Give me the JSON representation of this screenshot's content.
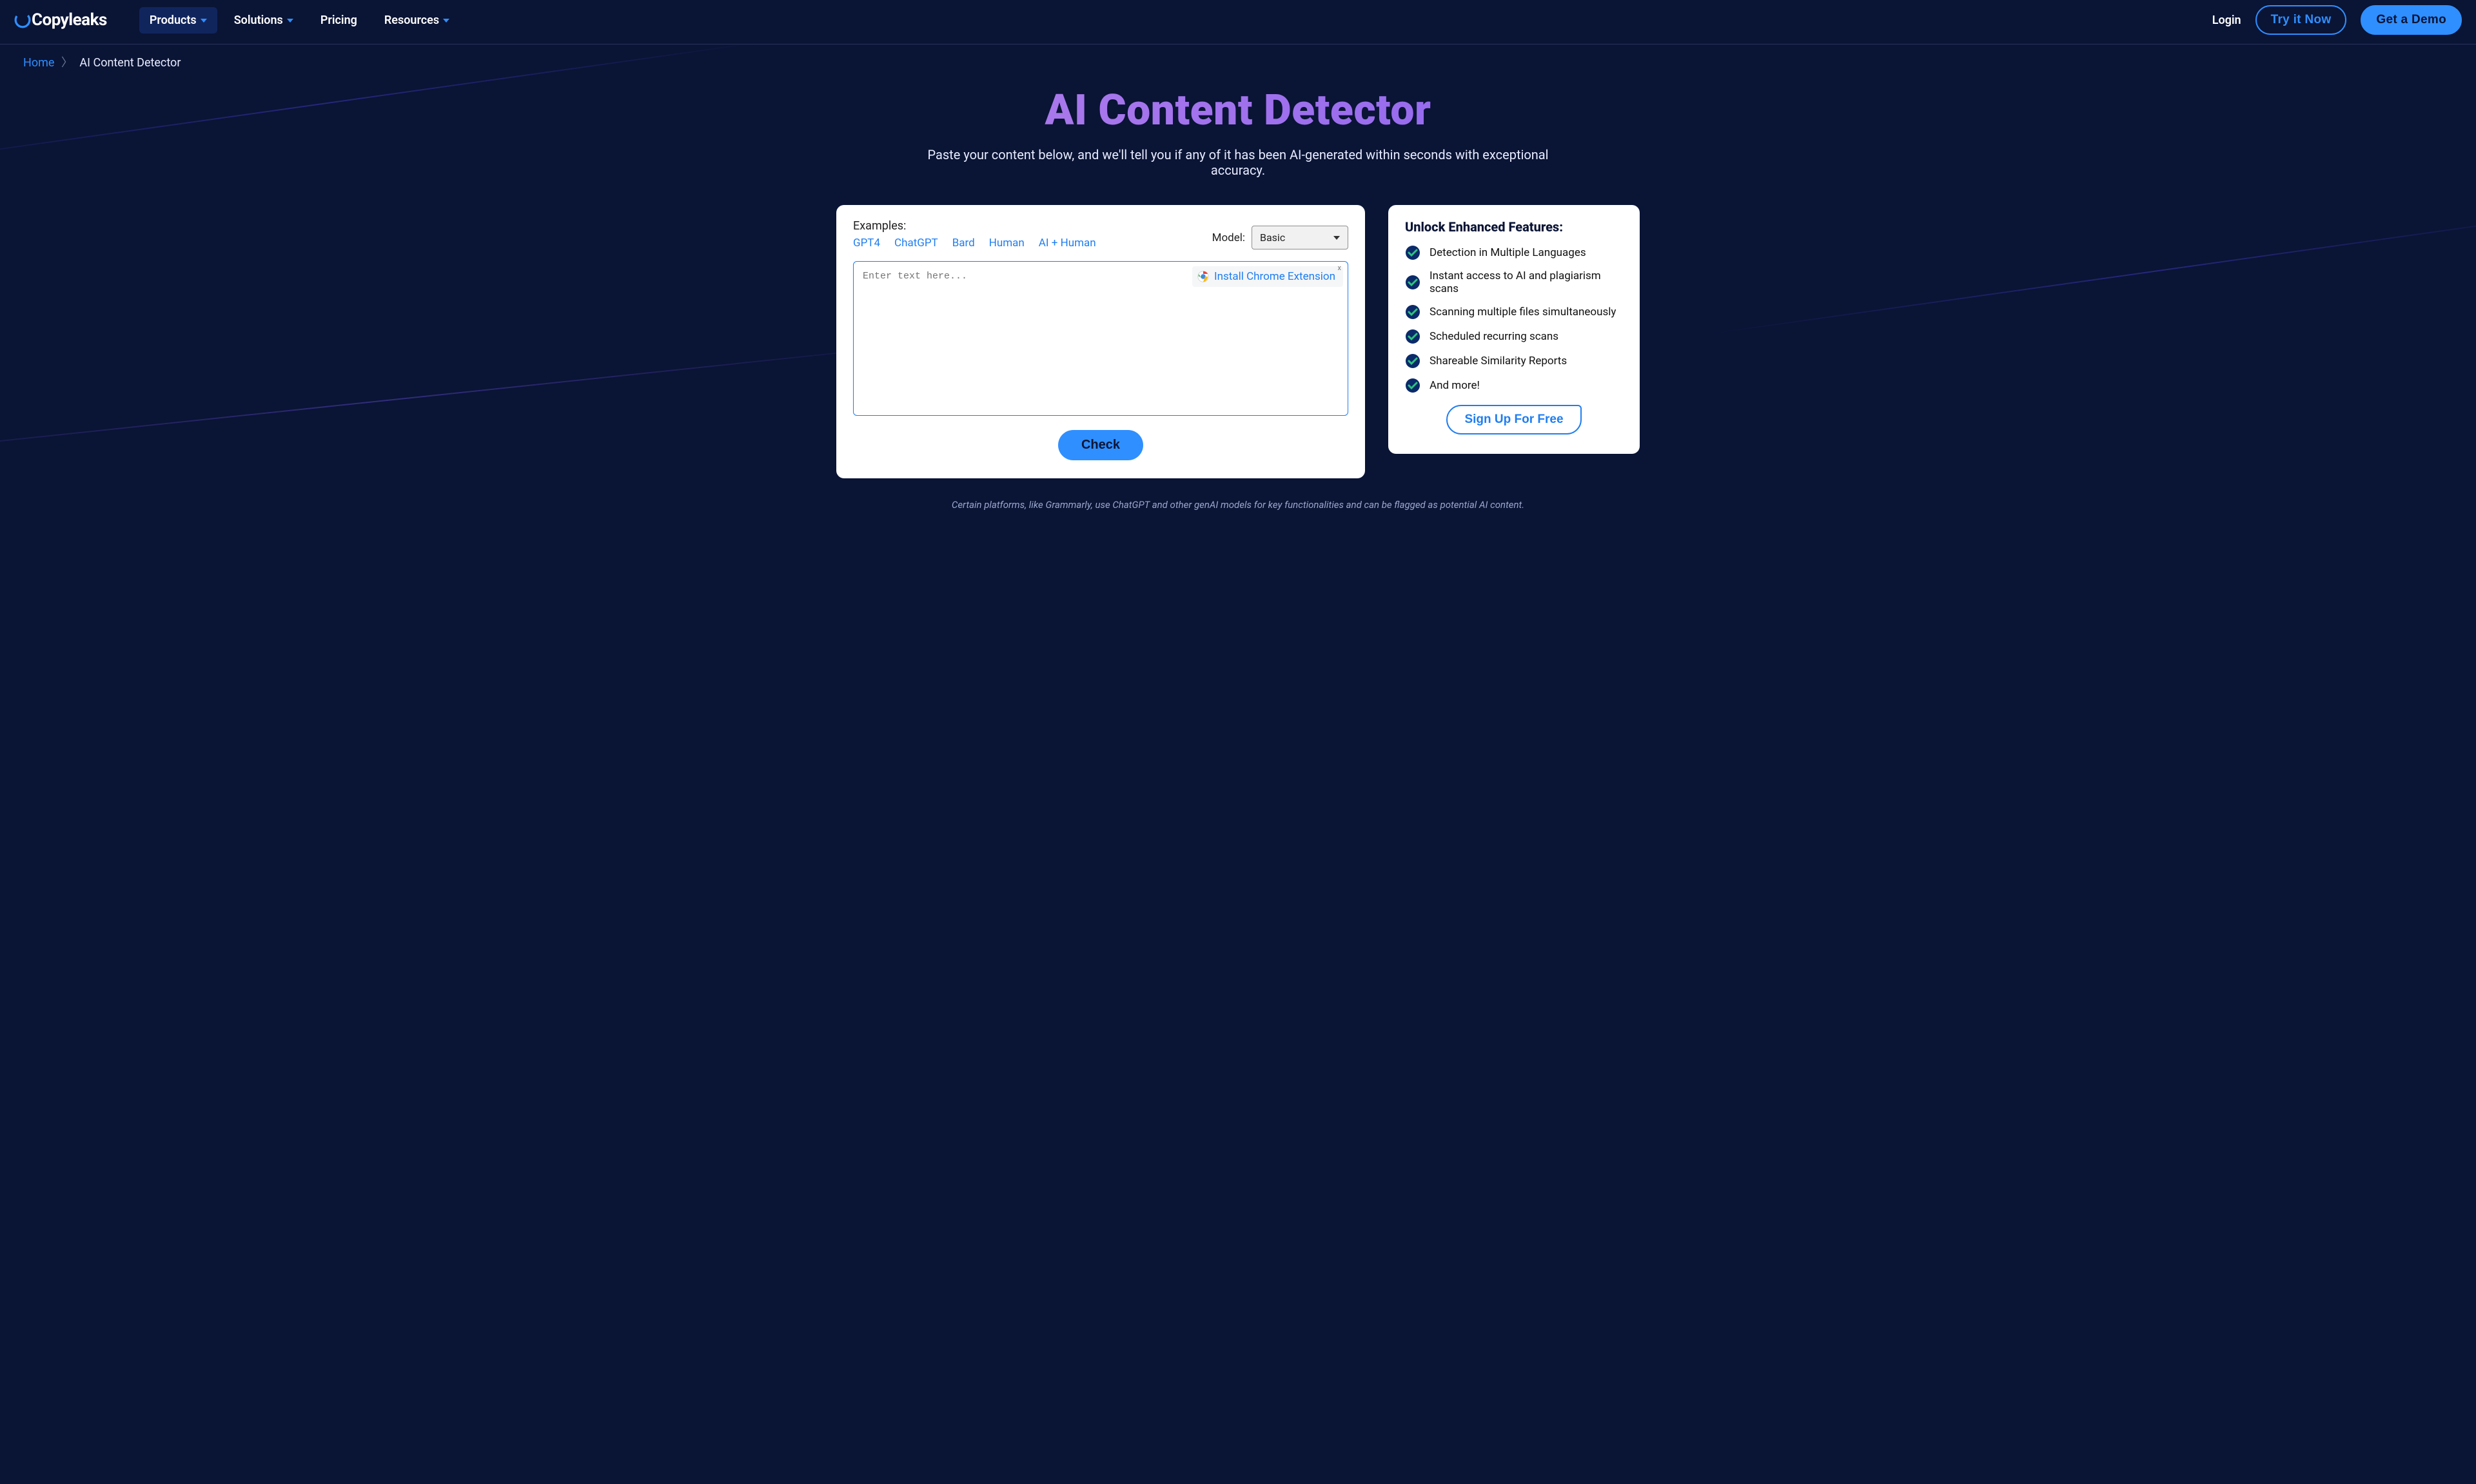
{
  "brand": "Copyleaks",
  "nav": {
    "items": [
      {
        "label": "Products",
        "dropdown": true,
        "active": true
      },
      {
        "label": "Solutions",
        "dropdown": true
      },
      {
        "label": "Pricing",
        "dropdown": false
      },
      {
        "label": "Resources",
        "dropdown": true
      }
    ],
    "login": "Login",
    "try": "Try it Now",
    "demo": "Get a Demo"
  },
  "breadcrumbs": {
    "home": "Home",
    "current": "AI Content Detector"
  },
  "hero": {
    "title": "AI Content Detector",
    "sub": "Paste your content below, and we'll tell you if any of it has been AI-generated within seconds with exceptional accuracy."
  },
  "editor": {
    "examples_label": "Examples:",
    "examples": [
      "GPT4",
      "ChatGPT",
      "Bard",
      "Human",
      "AI + Human"
    ],
    "model_label": "Model:",
    "model_value": "Basic",
    "placeholder": "Enter text here...",
    "chrome_chip": "Install Chrome Extension",
    "check": "Check"
  },
  "sidebar": {
    "title": "Unlock Enhanced Features:",
    "features": [
      "Detection in Multiple Languages",
      "Instant access to AI and plagiarism scans",
      "Scanning multiple files simultaneously",
      "Scheduled recurring scans",
      "Shareable Similarity Reports",
      "And more!"
    ],
    "signup": "Sign Up For Free"
  },
  "footnote": "Certain platforms, like Grammarly, use ChatGPT and other genAI models for key functionalities and can be flagged as potential AI content."
}
